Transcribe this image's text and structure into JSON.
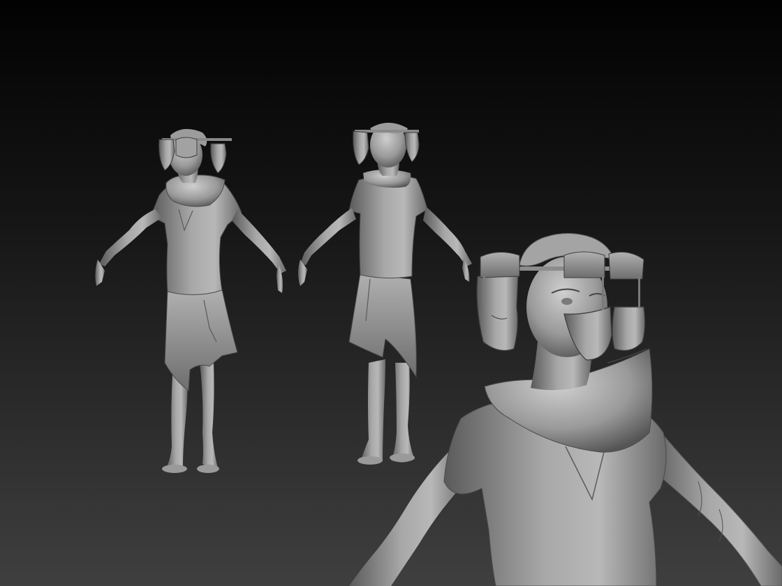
{
  "scene": {
    "background_top": "#020202",
    "background_bottom": "#3e3e3e",
    "clay_light": "#c4c4c4",
    "clay_mid": "#8d8d8d",
    "clay_dark": "#4a4a4a",
    "subjects": [
      "character-front-view",
      "character-back-view",
      "character-closeup-view"
    ]
  }
}
